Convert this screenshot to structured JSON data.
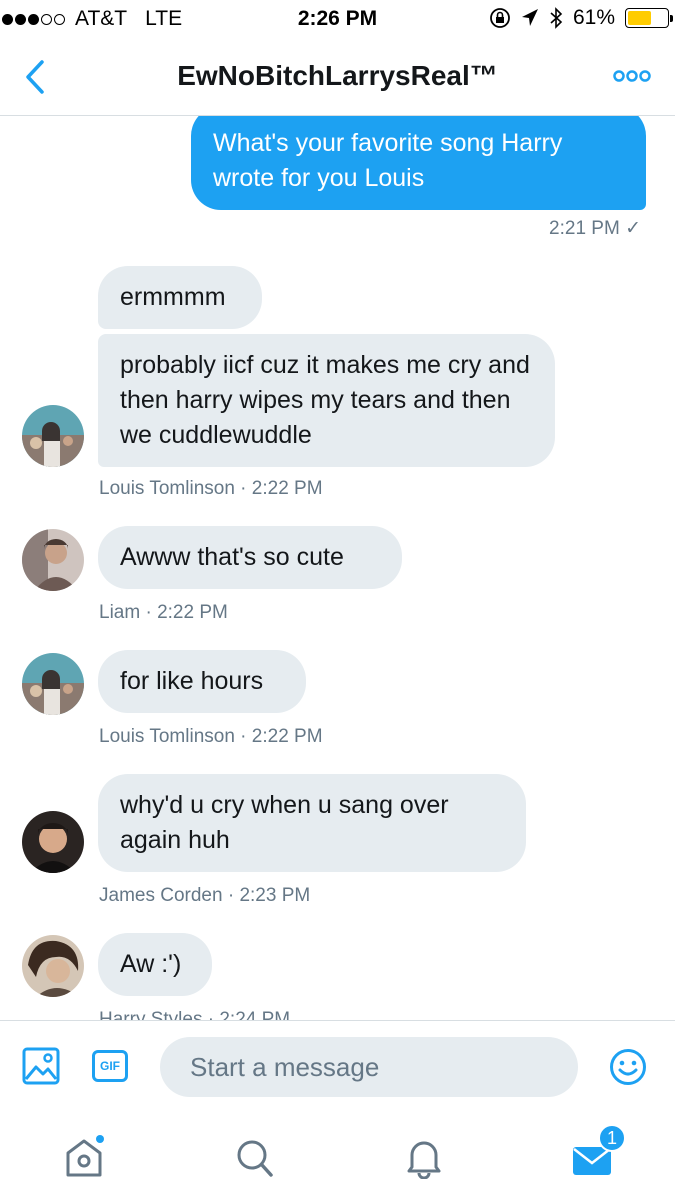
{
  "status_bar": {
    "carrier": "AT&T",
    "network": "LTE",
    "time": "2:26 PM",
    "battery": "61%",
    "battery_level": 0.61
  },
  "header": {
    "title": "EwNoBitchLarrysReal™",
    "back_icon": "chevron-left-icon",
    "more_icon": "more-dots-icon"
  },
  "messages": {
    "out1": {
      "text": "What's your favorite song Harry wrote for you Louis",
      "meta": "2:21 PM ✓"
    },
    "louis1": {
      "text1": "ermmmm",
      "text2": "probably iicf cuz it makes me cry and then harry wipes my tears and then we cuddlewuddle",
      "meta": "Louis Tomlinson · 2:22 PM"
    },
    "liam": {
      "text": "Awww that's so cute",
      "meta": "Liam · 2:22 PM"
    },
    "louis2": {
      "text": "for like hours",
      "meta": "Louis Tomlinson · 2:22 PM"
    },
    "james": {
      "text": "why'd u cry when u sang over again huh",
      "meta": "James Corden · 2:23 PM"
    },
    "harry": {
      "text": "Aw :')",
      "meta": "Harry Styles · 2:24 PM"
    }
  },
  "composer": {
    "placeholder": "Start a message",
    "gif_label": "GIF"
  },
  "tabbar": {
    "messages_badge": "1"
  },
  "colors": {
    "accent": "#1da1f2",
    "incoming_bubble": "#e6ecf0",
    "meta_text": "#657786"
  }
}
